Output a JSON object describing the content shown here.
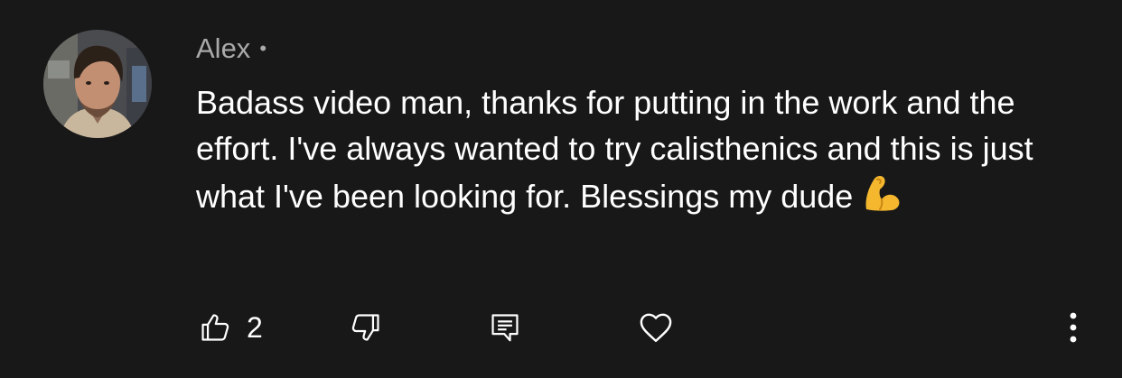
{
  "comment": {
    "author": "Alex",
    "separator": "•",
    "text": "Badass video man, thanks for putting in the work and the effort. I've always wanted to try calisthenics and this is just what I've been looking for. Blessings my dude",
    "emoji": "flexed-biceps",
    "like_count": "2"
  },
  "icons": {
    "like": "thumbs-up-icon",
    "dislike": "thumbs-down-icon",
    "reply": "reply-comment-icon",
    "heart": "heart-icon",
    "more": "more-vertical-icon"
  },
  "colors": {
    "background": "#181818",
    "text": "#ffffff",
    "muted": "#aaaaaa",
    "emoji": "#f5b72e"
  }
}
